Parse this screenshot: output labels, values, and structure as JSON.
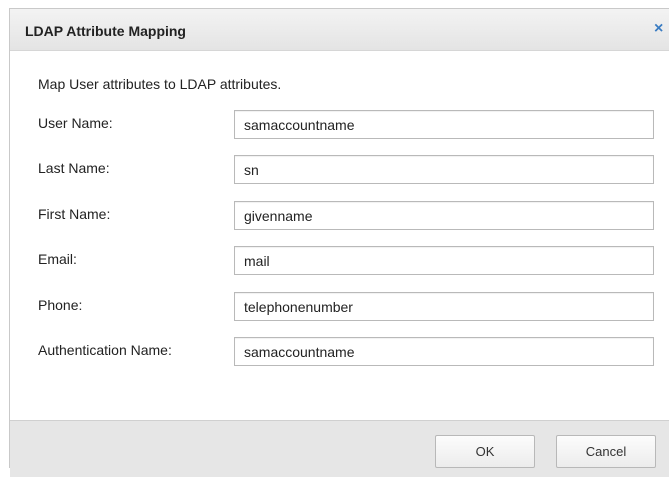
{
  "dialog": {
    "title": "LDAP Attribute Mapping",
    "close_glyph": "×",
    "close_icon": "close-icon"
  },
  "intro_text": "Map User attributes to LDAP attributes.",
  "fields": [
    {
      "label": "User Name:",
      "value": "samaccountname"
    },
    {
      "label": "Last Name:",
      "value": "sn"
    },
    {
      "label": "First Name:",
      "value": "givenname"
    },
    {
      "label": "Email:",
      "value": "mail"
    },
    {
      "label": "Phone:",
      "value": "telephonenumber"
    },
    {
      "label": "Authentication Name:",
      "value": "samaccountname"
    }
  ],
  "buttons": {
    "ok_label": "OK",
    "cancel_label": "Cancel"
  },
  "colors": {
    "close_icon": "#3a7cc2",
    "footer_bg": "#e6e6e6"
  }
}
